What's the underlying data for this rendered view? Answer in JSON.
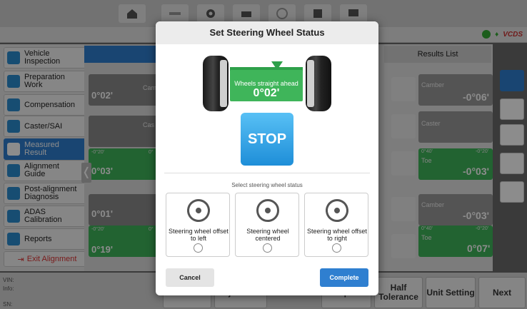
{
  "toolbar": {
    "icons": [
      "home-icon",
      "wheel-alignment-icon",
      "gear-icon",
      "printer-icon",
      "target-icon",
      "save-icon",
      "message-icon"
    ]
  },
  "header_logos": [
    "brand-logo-1",
    "brand-logo-2",
    "VCDS"
  ],
  "sidebar": {
    "items": [
      {
        "label": "Vehicle\nInspection",
        "icon": "car-icon"
      },
      {
        "label": "Preparation\nWork",
        "icon": "wrench-icon"
      },
      {
        "label": "Compensation",
        "icon": "compensation-icon"
      },
      {
        "label": "Caster/SAI",
        "icon": "caster-icon"
      },
      {
        "label": "Measured\nResult",
        "icon": "list-icon"
      },
      {
        "label": "Alignment\nGuide",
        "icon": "tools-icon"
      },
      {
        "label": "Post-alignment\nDiagnosis",
        "icon": "car-diag-icon"
      },
      {
        "label": "ADAS\nCalibration",
        "icon": "adas-icon"
      },
      {
        "label": "Reports",
        "icon": "reports-icon"
      }
    ],
    "exit_label": "Exit Alignment"
  },
  "main": {
    "values": [
      "0°02'",
      "Camb",
      "Cas",
      "0°03'",
      "0°01'",
      "0°19'"
    ],
    "range_labels": [
      "-0°20'",
      "0°",
      "-0°20'",
      "0°"
    ]
  },
  "results": {
    "title": "Results List",
    "items": [
      {
        "label": "Camber",
        "value": "-0°06'"
      },
      {
        "label": "Caster",
        "value": ""
      },
      {
        "label": "Toe",
        "value": "-0°03'",
        "range_left": "0°40'",
        "range_right": "-0°20'"
      },
      {
        "label": "Camber",
        "value": "-0°03'"
      },
      {
        "label": "Toe",
        "value": "0°07'",
        "range_left": "0°40'",
        "range_right": "-0°20'"
      }
    ]
  },
  "bottom": {
    "info_labels": [
      "VIN:",
      "Info:",
      "SN:"
    ],
    "buttons": [
      "Measurement",
      "Adjustment",
      "Half\nTolerance",
      "Unit Setting",
      "Next"
    ],
    "partial": [
      "Repair"
    ]
  },
  "modal": {
    "title": "Set Steering Wheel Status",
    "status_label": "Wheels straight ahead",
    "status_value": "0°02'",
    "stop_label": "STOP",
    "select_label": "Select steering wheel status",
    "options": [
      {
        "label": "Steering wheel offset to left"
      },
      {
        "label": "Steering wheel centered"
      },
      {
        "label": "Steering wheel offset to right"
      }
    ],
    "cancel_label": "Cancel",
    "complete_label": "Complete"
  }
}
